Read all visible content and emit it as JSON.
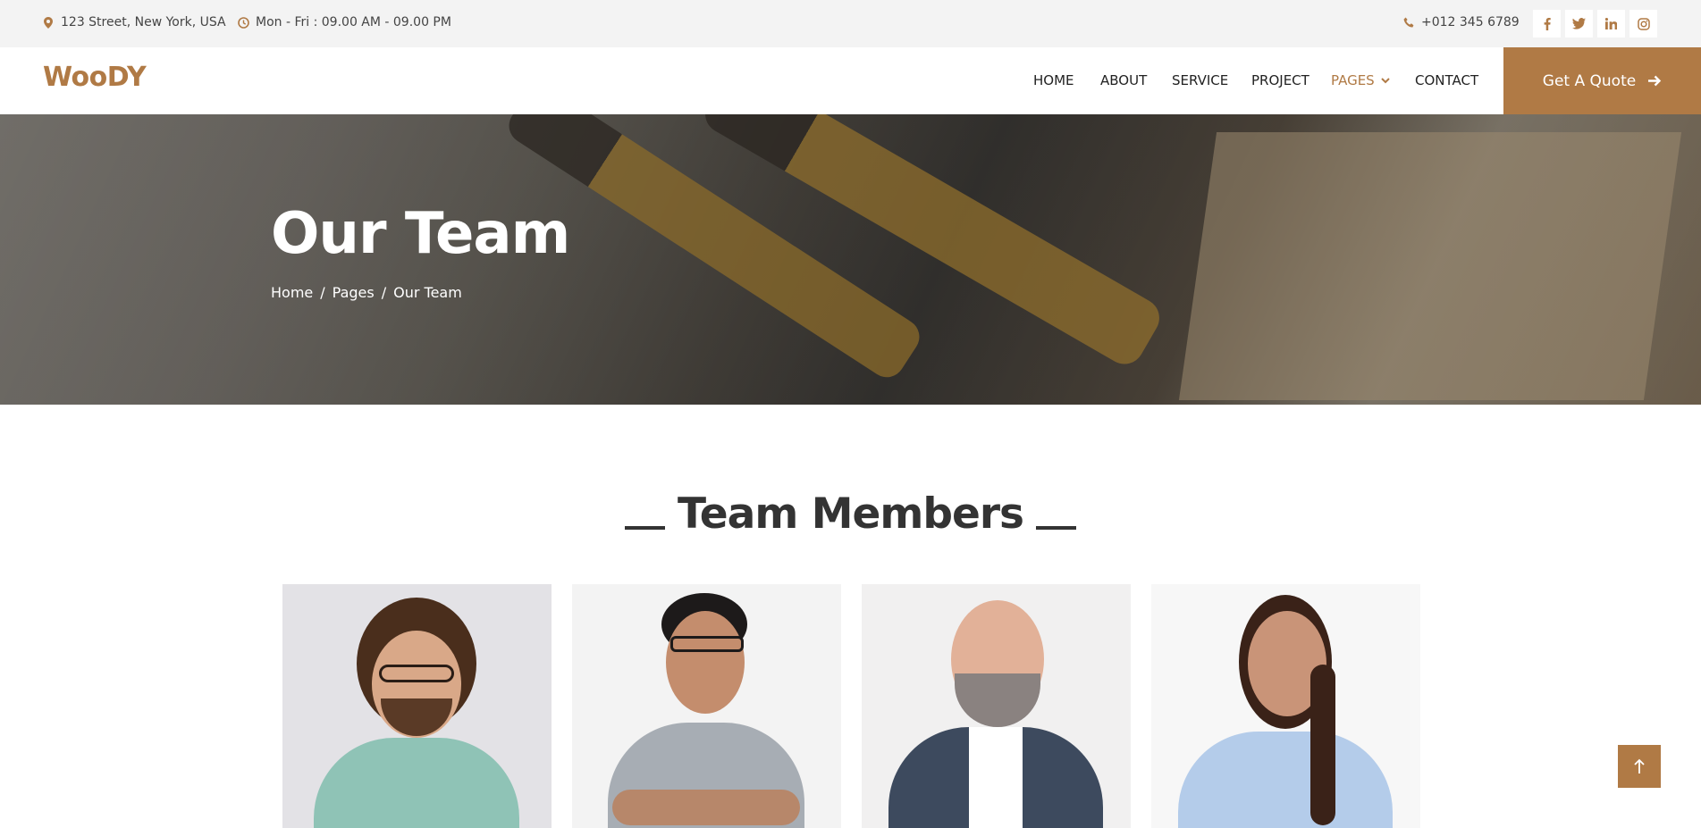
{
  "topbar": {
    "address": "123 Street, New York, USA",
    "hours": "Mon - Fri : 09.00 AM - 09.00 PM",
    "phone": "+012 345 6789",
    "socials": [
      "facebook-icon",
      "twitter-icon",
      "linkedin-icon",
      "instagram-icon"
    ]
  },
  "nav": {
    "logo": "WooDY",
    "items": [
      "HOME",
      "ABOUT",
      "SERVICE",
      "PROJECT",
      "PAGES",
      "CONTACT"
    ],
    "active": "PAGES",
    "cta": "Get A Quote"
  },
  "hero": {
    "title": "Our Team",
    "breadcrumb": [
      "Home",
      "Pages",
      "Our Team"
    ],
    "separator": "/"
  },
  "section": {
    "title": "Team Members"
  },
  "team": {
    "members": [
      {
        "photo": "team-photo-1"
      },
      {
        "photo": "team-photo-2"
      },
      {
        "photo": "team-photo-3"
      },
      {
        "photo": "team-photo-4"
      }
    ]
  },
  "colors": {
    "accent": "#b07a45",
    "topbar_bg": "#f3f3f3",
    "text_dark": "#333333"
  }
}
